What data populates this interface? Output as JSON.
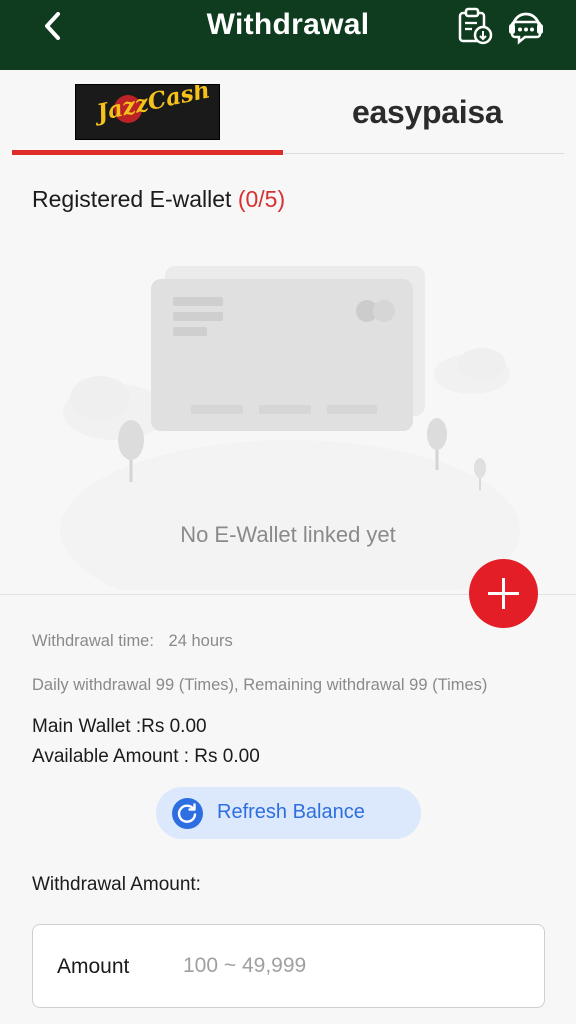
{
  "header": {
    "title": "Withdrawal",
    "back_icon": "chevron-left-icon",
    "records_icon": "clipboard-download-icon",
    "support_icon": "chat-support-icon",
    "bg_color": "#0f3b1f"
  },
  "tabs": [
    {
      "label": "JazzCash",
      "active": true
    },
    {
      "label": "easypaisa",
      "active": false
    }
  ],
  "ewallet": {
    "title": "Registered E-wallet",
    "count": "(0/5)",
    "empty_text": "No E-Wallet linked yet",
    "add_icon": "plus-icon"
  },
  "info": {
    "withdrawal_time_label": "Withdrawal time:",
    "withdrawal_time_value": "24 hours",
    "daily_text": "Daily withdrawal 99 (Times), Remaining withdrawal 99 (Times)",
    "main_wallet": "Main Wallet :Rs 0.00",
    "available_amount": "Available Amount : Rs 0.00"
  },
  "refresh": {
    "label": "Refresh Balance",
    "icon": "refresh-icon"
  },
  "withdraw": {
    "section_label": "Withdrawal Amount:",
    "field_label": "Amount",
    "placeholder": "100 ~ 49,999"
  },
  "colors": {
    "accent_red": "#e41e26",
    "count_red": "#d63232",
    "refresh_blue": "#2d6fe0",
    "easypaisa_green": "#1faa59"
  }
}
